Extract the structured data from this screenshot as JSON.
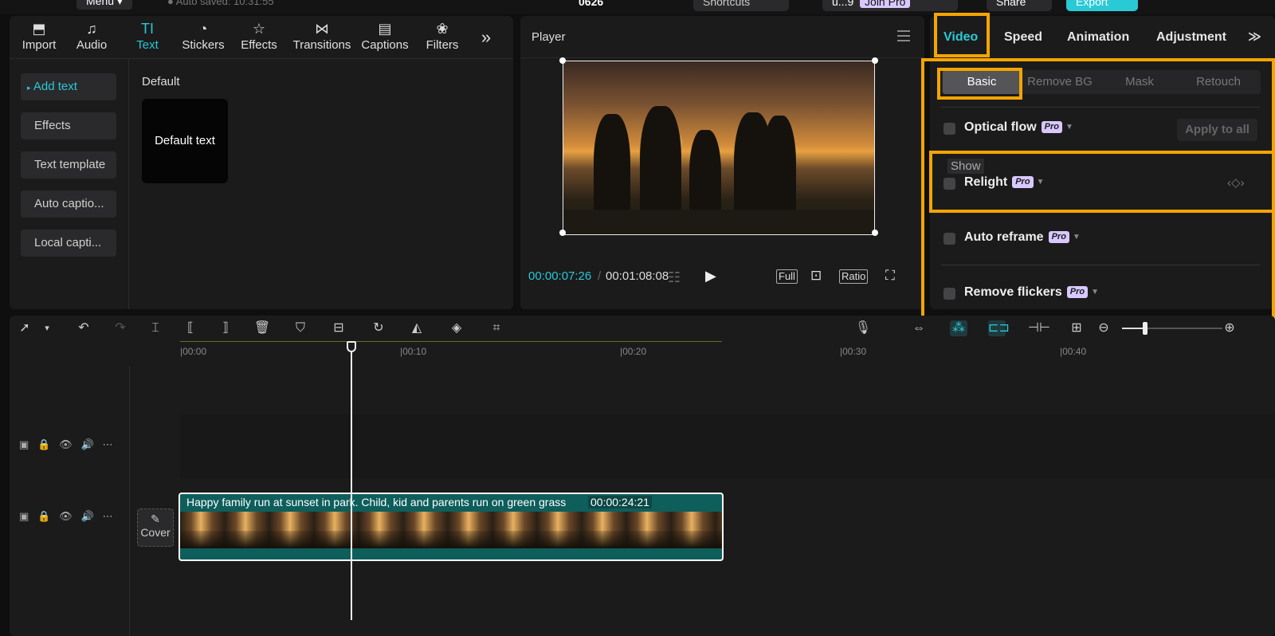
{
  "topbar": {
    "menu": "Menu",
    "autosave": "Auto saved: 10:31:55",
    "project": "0626",
    "shortcuts": "Shortcuts",
    "user": "u...9",
    "join_pro": "Join Pro",
    "share": "Share",
    "export": "Export"
  },
  "media": {
    "tabs": [
      {
        "label": "Import",
        "icon": "import-icon"
      },
      {
        "label": "Audio",
        "icon": "audio-icon"
      },
      {
        "label": "Text",
        "icon": "text-icon",
        "glyph": "TI"
      },
      {
        "label": "Stickers",
        "icon": "stickers-icon"
      },
      {
        "label": "Effects",
        "icon": "effects-icon"
      },
      {
        "label": "Transitions",
        "icon": "transitions-icon"
      },
      {
        "label": "Captions",
        "icon": "captions-icon"
      },
      {
        "label": "Filters",
        "icon": "filters-icon"
      }
    ],
    "more": "»",
    "side": [
      "Add text",
      "Effects",
      "Text template",
      "Auto captio...",
      "Local capti..."
    ],
    "section": "Default",
    "card": "Default text"
  },
  "player": {
    "title": "Player",
    "current": "00:00:07:26",
    "separator": "/",
    "total": "00:01:08:08",
    "full": "Full",
    "ratio": "Ratio"
  },
  "props": {
    "tabs": [
      "Video",
      "Speed",
      "Animation",
      "Adjustment"
    ],
    "subtabs": [
      "Basic",
      "Remove BG",
      "Mask",
      "Retouch"
    ],
    "pro_badge": "Pro",
    "optical_flow": "Optical flow",
    "apply_all": "Apply to all",
    "tooltip": "Show",
    "relight": "Relight",
    "auto_reframe": "Auto reframe",
    "remove_flickers": "Remove flickers",
    "accent": "#2ac9d6",
    "highlight": "#f5a500"
  },
  "timeline": {
    "ticks": [
      "|00:00",
      "|00:10",
      "|00:20",
      "|00:30",
      "|00:40"
    ],
    "cover": "Cover",
    "clip_title": "Happy family run at sunset in park. Child, kid and parents run on green grass",
    "clip_duration": "00:00:24:21"
  }
}
